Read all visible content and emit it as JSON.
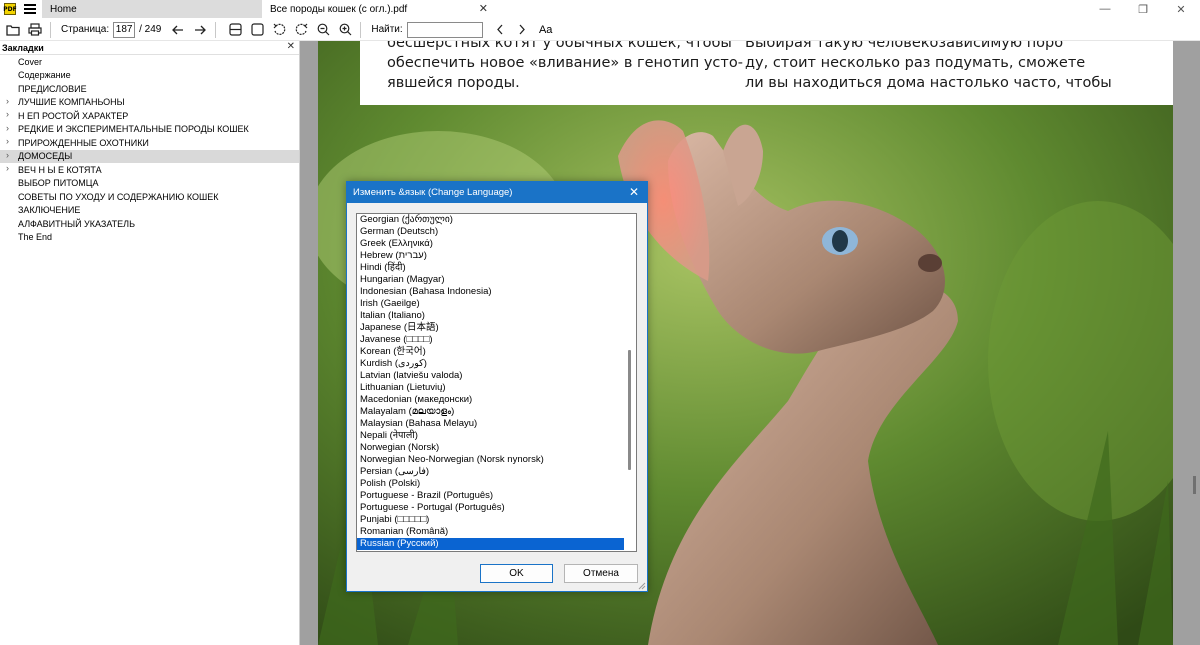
{
  "tabs": {
    "home_label": "Home",
    "doc_label": "Все породы кошек (с огл.).pdf",
    "close_glyph": "✕"
  },
  "window": {
    "minimize": "—",
    "maximize": "❐",
    "close": "✕"
  },
  "toolbar": {
    "page_label": "Страница:",
    "page_current": "187",
    "page_total": "/ 249",
    "find_label": "Найти:",
    "find_value": "",
    "font_icon": "Aa"
  },
  "sidebar": {
    "title": "Закладки",
    "close_glyph": "✕",
    "items": [
      {
        "label": "Cover",
        "has_children": false,
        "selected": false
      },
      {
        "label": "Содержание",
        "has_children": false,
        "selected": false
      },
      {
        "label": "ПРЕДИСЛОВИЕ",
        "has_children": false,
        "selected": false
      },
      {
        "label": "ЛУЧШИЕ КОМПАНЬОНЫ",
        "has_children": true,
        "selected": false
      },
      {
        "label": "Н ЕП РОСТОЙ ХАРАКТЕР",
        "has_children": true,
        "selected": false
      },
      {
        "label": "РЕДКИЕ И ЭКСПЕРИМЕНТАЛЬНЫЕ ПОРОДЫ КОШЕК",
        "has_children": true,
        "selected": false
      },
      {
        "label": "ПРИРОЖДЕННЫЕ ОХОТНИКИ",
        "has_children": true,
        "selected": false
      },
      {
        "label": "ДОМОСЕДЫ",
        "has_children": true,
        "selected": true
      },
      {
        "label": "ВЕЧ Н Ы Е КОТЯТА",
        "has_children": true,
        "selected": false
      },
      {
        "label": "ВЫБОР ПИТОМЦА",
        "has_children": false,
        "selected": false
      },
      {
        "label": "СОВЕТЫ ПО УХОДУ И СОДЕРЖАНИЮ КОШЕК",
        "has_children": false,
        "selected": false
      },
      {
        "label": "ЗАКЛЮЧЕНИЕ",
        "has_children": false,
        "selected": false
      },
      {
        "label": "АЛФАВИТНЫЙ УКАЗАТЕЛЬ",
        "has_children": false,
        "selected": false
      },
      {
        "label": "The End",
        "has_children": false,
        "selected": false
      }
    ]
  },
  "document": {
    "col1_lines": [
      "бесшерстных котят у обычных кошек, чтобы",
      "обеспечить новое «вливание» в генотип усто-",
      "явшейся породы."
    ],
    "col2_lines": [
      "Выбирая такую человекозависимую поро",
      "ду, стоит несколько раз подумать, сможете",
      "ли вы находиться дома настолько часто, чтобы"
    ]
  },
  "dialog": {
    "title": "Изменить &язык (Change Language)",
    "close_glyph": "✕",
    "ok_label": "OK",
    "cancel_label": "Отмена",
    "selected": "Russian (Русский)",
    "languages": [
      "Georgian (ქართული)",
      "German (Deutsch)",
      "Greek (Ελληνικά)",
      "Hebrew (עברית)",
      "Hindi (हिंदी)",
      "Hungarian (Magyar)",
      "Indonesian (Bahasa Indonesia)",
      "Irish (Gaeilge)",
      "Italian (Italiano)",
      "Japanese (日本語)",
      "Javanese (□□□□)",
      "Korean (한국어)",
      "Kurdish (کوردی)",
      "Latvian (latviešu valoda)",
      "Lithuanian (Lietuvių)",
      "Macedonian (македонски)",
      "Malayalam (മലയാളം)",
      "Malaysian (Bahasa Melayu)",
      "Nepali (नेपाली)",
      "Norwegian (Norsk)",
      "Norwegian Neo-Norwegian (Norsk nynorsk)",
      "Persian (فارسی)",
      "Polish (Polski)",
      "Portuguese - Brazil (Português)",
      "Portuguese - Portugal (Português)",
      "Punjabi (□□□□□)",
      "Romanian (Română)",
      "Russian (Русский)"
    ]
  }
}
